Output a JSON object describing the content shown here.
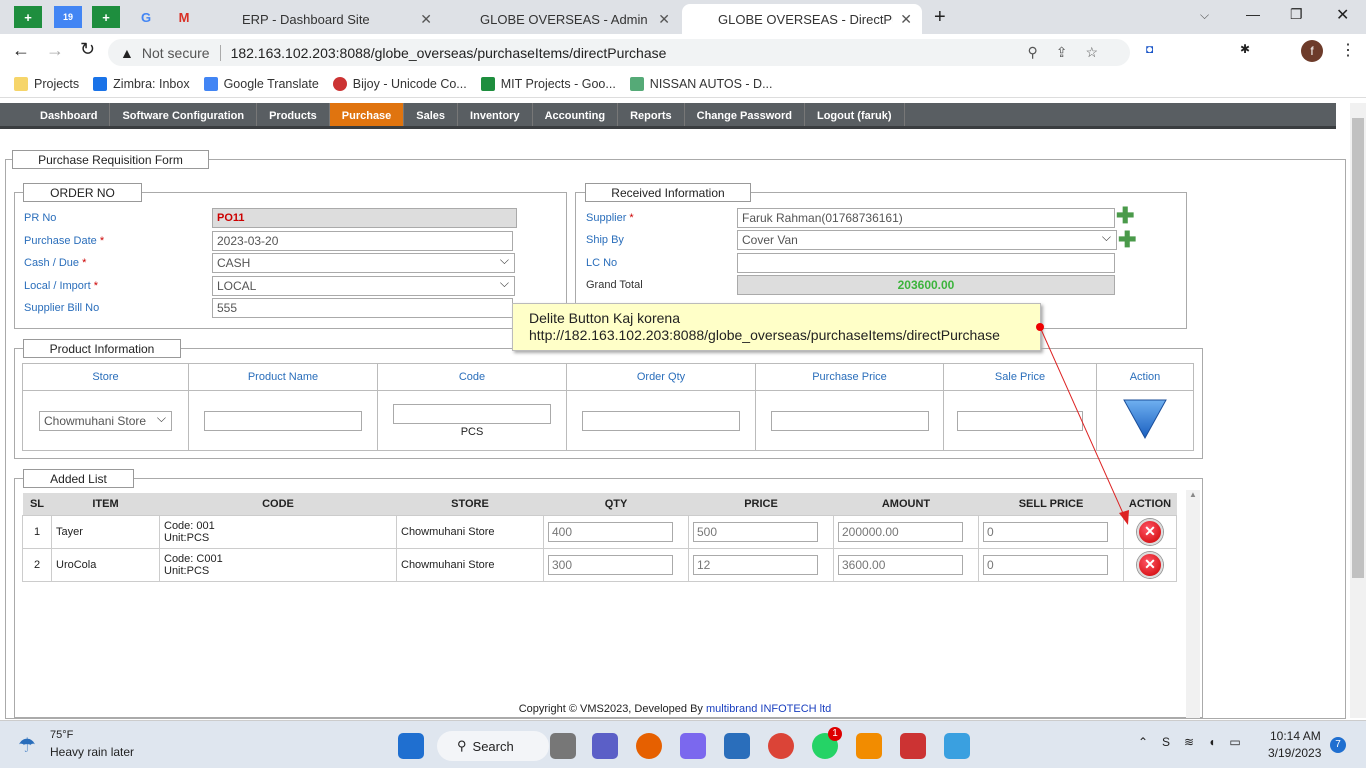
{
  "browser": {
    "tabs": [
      {
        "title": "ERP - Dashboard Site"
      },
      {
        "title": "GLOBE OVERSEAS - Admin Suppl"
      },
      {
        "title": "GLOBE OVERSEAS - DirectPurcha"
      }
    ],
    "security": "Not secure",
    "url": "182.163.102.203:8088/globe_overseas/purchaseItems/directPurchase",
    "bookmarks": [
      "Projects",
      "Zimbra: Inbox",
      "Google Translate",
      "Bijoy - Unicode Co...",
      "MIT Projects - Goo...",
      "NISSAN AUTOS - D..."
    ],
    "profile": "f"
  },
  "nav": [
    "Dashboard",
    "Software Configuration",
    "Products",
    "Purchase",
    "Sales",
    "Inventory",
    "Accounting",
    "Reports",
    "Change Password",
    "Logout (faruk)"
  ],
  "form": {
    "title": "Purchase Requisition Form",
    "order": {
      "legend": "ORDER NO",
      "pr_label": "PR No",
      "pr": "PO11",
      "date_label": "Purchase Date",
      "date": "2023-03-20",
      "cash_label": "Cash / Due",
      "cash": "CASH",
      "local_label": "Local / Import",
      "local": "LOCAL",
      "bill_label": "Supplier Bill No",
      "bill": "555",
      "req": "*"
    },
    "received": {
      "legend": "Received Information",
      "supplier_label": "Supplier",
      "supplier": "Faruk Rahman(01768736161)",
      "ship_label": "Ship By",
      "ship": "Cover Van",
      "lc_label": "LC No",
      "lc": "",
      "total_label": "Grand Total",
      "total": "203600.00"
    },
    "product": {
      "legend": "Product Information",
      "headers": [
        "Store",
        "Product Name",
        "Code",
        "Order Qty",
        "Purchase Price",
        "Sale Price",
        "Action"
      ],
      "store": "Chowmuhani Store",
      "unit": "PCS"
    },
    "added": {
      "legend": "Added List",
      "headers": [
        "SL",
        "ITEM",
        "CODE",
        "STORE",
        "QTY",
        "PRICE",
        "AMOUNT",
        "SELL PRICE",
        "ACTION"
      ],
      "rows": [
        {
          "sl": "1",
          "item": "Tayer",
          "code": "Code: 001",
          "unit": "Unit:PCS",
          "store": "Chowmuhani Store",
          "qty": "400",
          "price": "500",
          "amount": "200000.00",
          "sell": "0"
        },
        {
          "sl": "2",
          "item": "UroCola",
          "code": "Code: C001",
          "unit": "Unit:PCS",
          "store": "Chowmuhani Store",
          "qty": "300",
          "price": "12",
          "amount": "3600.00",
          "sell": "0"
        }
      ]
    }
  },
  "annotation": {
    "line1": "Delite Button Kaj korena",
    "line2": "http://182.163.102.203:8088/globe_overseas/purchaseItems/directPurchase"
  },
  "footer": {
    "text": "Copyright © VMS2023, Developed By ",
    "link": "multibrand INFOTECH ltd"
  },
  "taskbar": {
    "temp": "75°F",
    "weather": "Heavy rain later",
    "search": "Search",
    "time": "10:14 AM",
    "date": "3/19/2023",
    "notif": "7",
    "wa_badge": "1"
  }
}
